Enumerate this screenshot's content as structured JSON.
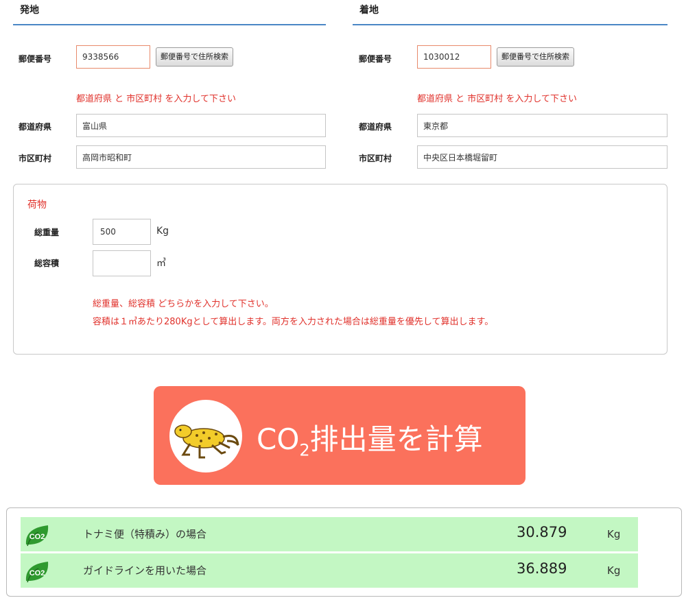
{
  "origin": {
    "title": "発地",
    "zip_label": "郵便番号",
    "zip_value": "9338566",
    "search_button": "郵便番号で住所検索",
    "hint": "都道府県 と 市区町村 を入力して下さい",
    "pref_label": "都道府県",
    "pref_value": "富山県",
    "city_label": "市区町村",
    "city_value": "高岡市昭和町"
  },
  "destination": {
    "title": "着地",
    "zip_label": "郵便番号",
    "zip_value": "1030012",
    "search_button": "郵便番号で住所検索",
    "hint": "都道府県 と 市区町村 を入力して下さい",
    "pref_label": "都道府県",
    "pref_value": "東京都",
    "city_label": "市区町村",
    "city_value": "中央区日本橋堀留町"
  },
  "cargo": {
    "title": "荷物",
    "weight_label": "総重量",
    "weight_value": "500",
    "weight_unit": "Kg",
    "volume_label": "総容積",
    "volume_value": "",
    "volume_unit": "㎥",
    "note1": "総重量、総容積 どちらかを入力して下さい。",
    "note2": "容積は１㎥あたり280Kgとして算出します。両方を入力された場合は総重量を優先して算出します。"
  },
  "calculate": {
    "label_prefix": "CO",
    "label_sub": "2",
    "label_suffix": "排出量を計算"
  },
  "results": [
    {
      "icon_text": "CO2",
      "label": "トナミ便（特積み）の場合",
      "value": "30.879",
      "unit": "Kg"
    },
    {
      "icon_text": "CO2",
      "label": "ガイドラインを用いた場合",
      "value": "36.889",
      "unit": "Kg"
    }
  ],
  "colors": {
    "accent_rule": "#4a86c5",
    "hint_red": "#e0312b",
    "button_orange": "#fb715c",
    "result_green": "#c3f7c3"
  }
}
